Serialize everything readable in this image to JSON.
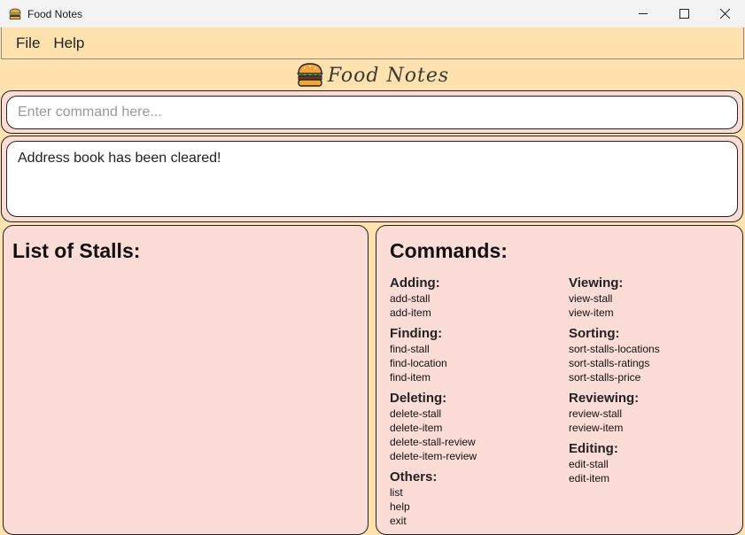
{
  "window": {
    "title": "Food Notes",
    "icon": "burger-icon"
  },
  "menu": [
    "File",
    "Help"
  ],
  "logo": {
    "text": "Food Notes",
    "icon": "burger-icon"
  },
  "command_box": {
    "placeholder": "Enter command here..."
  },
  "result": {
    "message": "Address book has been cleared!"
  },
  "stall_list": {
    "heading": "List of Stalls:"
  },
  "help": {
    "heading": "Commands:",
    "left_groups": [
      {
        "title": "Adding:",
        "commands": [
          "add-stall",
          "add-item"
        ]
      },
      {
        "title": "Finding:",
        "commands": [
          "find-stall",
          "find-location",
          "find-item"
        ]
      },
      {
        "title": "Deleting:",
        "commands": [
          "delete-stall",
          "delete-item",
          "delete-stall-review",
          "delete-item-review"
        ]
      },
      {
        "title": "Others:",
        "commands": [
          "list",
          "help",
          "exit"
        ]
      }
    ],
    "right_groups": [
      {
        "title": "Viewing:",
        "commands": [
          "view-stall",
          "view-item"
        ]
      },
      {
        "title": "Sorting:",
        "commands": [
          "sort-stalls-locations",
          "sort-stalls-ratings",
          "sort-stalls-price"
        ]
      },
      {
        "title": "Reviewing:",
        "commands": [
          "review-stall",
          "review-item"
        ]
      },
      {
        "title": "Editing:",
        "commands": [
          "edit-stall",
          "edit-item"
        ]
      }
    ]
  },
  "colors": {
    "background": "#ffe2ad",
    "panel": "#fbdcd6",
    "border": "#222222"
  }
}
